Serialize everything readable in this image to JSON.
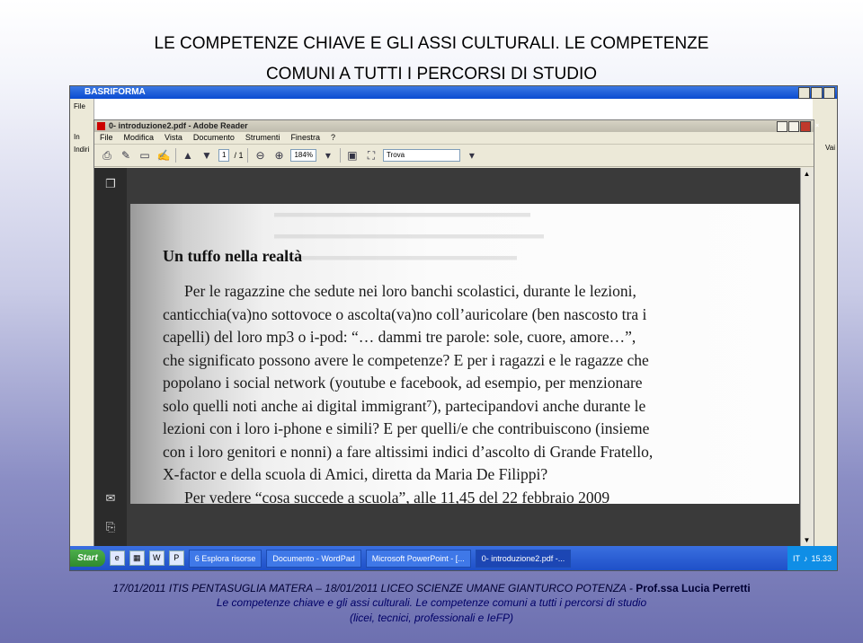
{
  "slide": {
    "title_line1": "LE COMPETENZE CHIAVE E GLI ASSI CULTURALI. LE COMPETENZE",
    "title_line2": "COMUNI A TUTTI I PERCORSI DI STUDIO",
    "footer_line1_prefix": "17/01/2011 ITIS PENTASUGLIA MATERA – 18/01/2011 LICEO SCIENZE UMANE GIANTURCO POTENZA -",
    "footer_line1_author": "Prof.ssa Lucia Perretti",
    "footer_line2": "Le competenze chiave e gli assi culturali. Le competenze comuni a tutti i percorsi di studio",
    "footer_line3": "(licei, tecnici, professionali e IeFP)"
  },
  "outer_window": {
    "title": "BASRIFORMA",
    "left_labels": [
      "File",
      "In",
      "Indiri"
    ],
    "right_label": "Vai"
  },
  "adobe": {
    "title": "0- introduzione2.pdf - Adobe Reader",
    "menu": [
      "File",
      "Modifica",
      "Vista",
      "Documento",
      "Strumenti",
      "Finestra",
      "?"
    ],
    "page_current": "1",
    "page_total": "/ 1",
    "zoom": "184%",
    "search_placeholder": "Trova"
  },
  "document": {
    "heading": "Un tuffo nella realtà",
    "lines": [
      "Per le ragazzine che sedute nei loro banchi scolastici, durante le lezioni,",
      "canticchia(va)no sottovoce o ascolta(va)no coll’auricolare (ben nascosto tra i",
      "capelli) del loro mp3 o i-pod: “… dammi tre parole: sole, cuore, amore…”,",
      "che significato possono avere le competenze? E per i ragazzi e le ragazze che",
      "popolano i social network (youtube e facebook, ad esempio, per menzionare",
      "solo quelli noti anche ai digital immigrant⁷), partecipandovi anche durante le",
      "lezioni con i loro i-phone e simili? E per quelli/e che contribuiscono (insieme",
      "con i loro genitori e nonni) a fare altissimi indici d’ascolto di Grande Fratello,",
      "X-factor e della scuola di Amici, diretta da Maria De Filippi?",
      "Per vedere “cosa succede a scuola”, alle 11,45 del 22 febbraio 2009"
    ]
  },
  "taskbar": {
    "start": "Start",
    "items": [
      "6 Esplora risorse",
      "Documento - WordPad",
      "Microsoft PowerPoint - [...",
      "0- introduzione2.pdf -..."
    ],
    "lang": "IT",
    "clock": "15.33"
  }
}
